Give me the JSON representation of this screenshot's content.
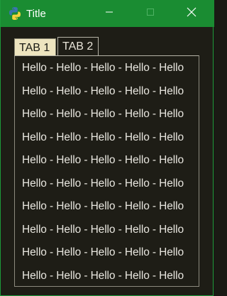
{
  "window": {
    "title": "Title",
    "icon": "python-icon",
    "accent_color": "#1a8c32"
  },
  "titlebar_buttons": {
    "minimize": "minimize-icon",
    "maximize": "maximize-icon",
    "close": "close-icon"
  },
  "tabs": [
    {
      "label": "TAB 1",
      "selected": true
    },
    {
      "label": "TAB 2",
      "selected": false
    }
  ],
  "panel": {
    "lines": [
      "Hello - Hello - Hello - Hello - Hello",
      "Hello - Hello - Hello - Hello - Hello",
      "Hello - Hello - Hello - Hello - Hello",
      "Hello - Hello - Hello - Hello - Hello",
      "Hello - Hello - Hello - Hello - Hello",
      "Hello - Hello - Hello - Hello - Hello",
      "Hello - Hello - Hello - Hello - Hello",
      "Hello - Hello - Hello - Hello - Hello",
      "Hello - Hello - Hello - Hello - Hello",
      "Hello - Hello - Hello - Hello - Hello"
    ]
  }
}
